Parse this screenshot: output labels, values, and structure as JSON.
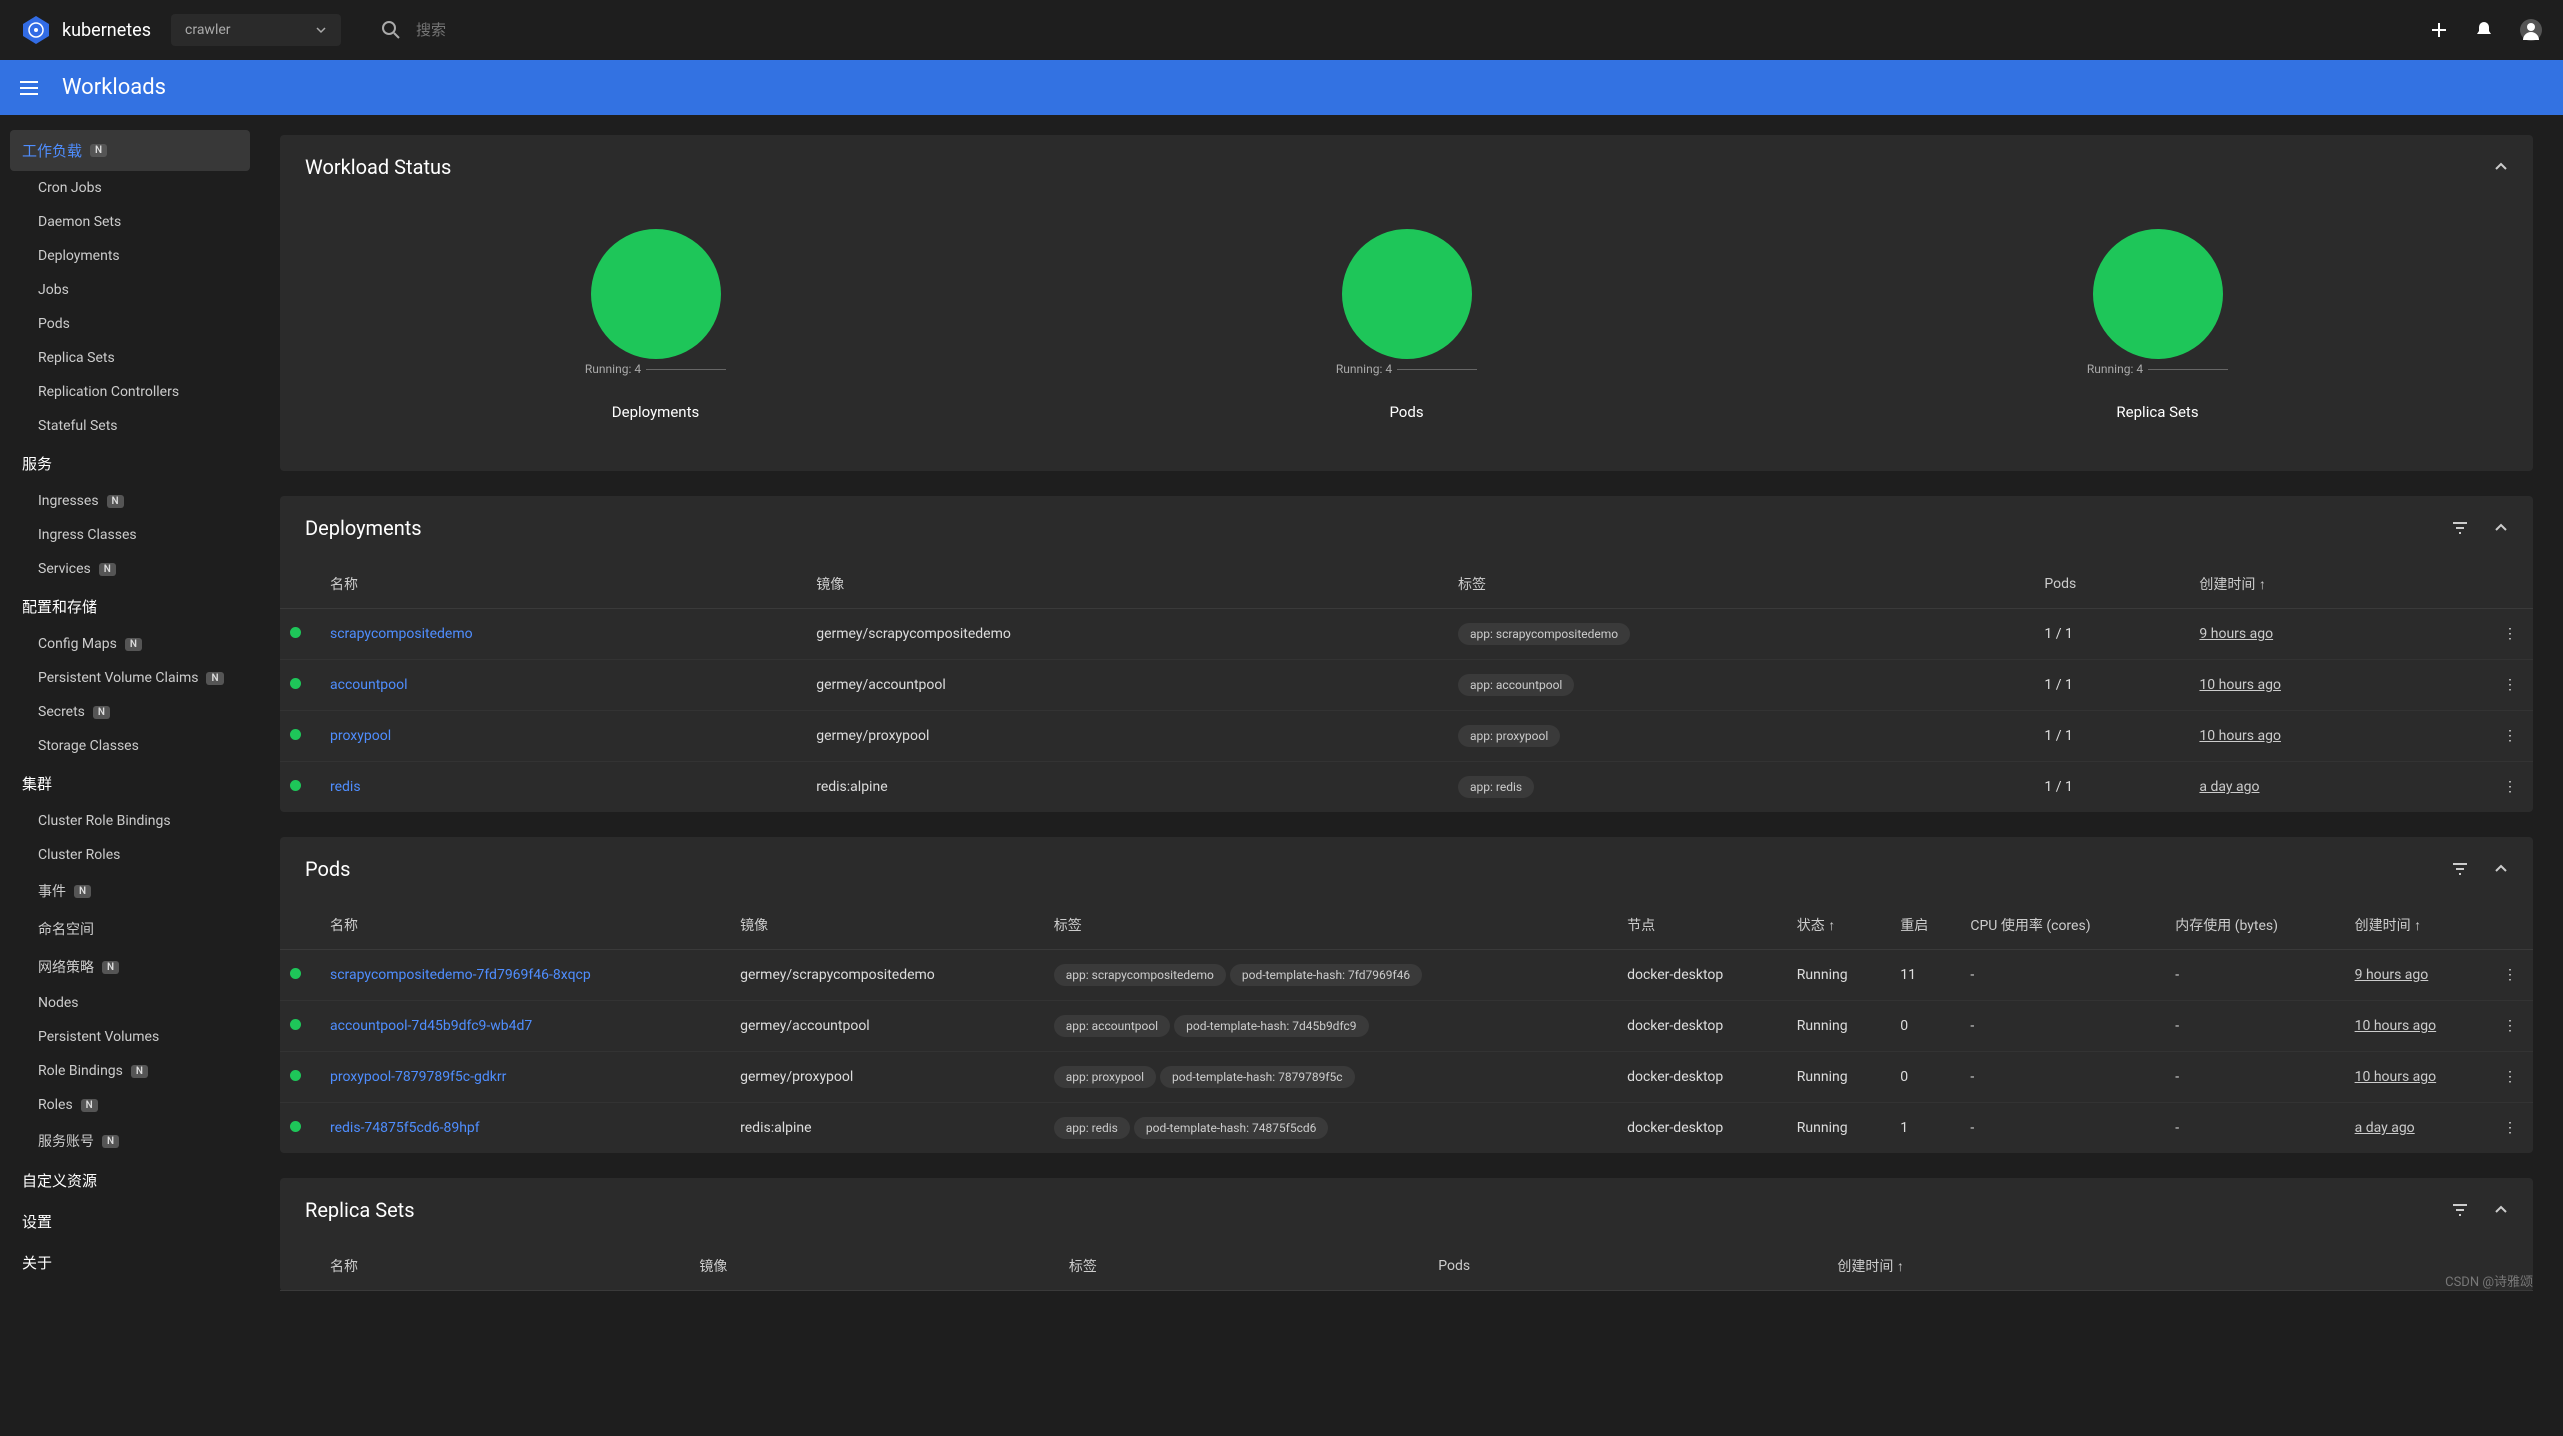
{
  "header": {
    "brand": "kubernetes",
    "namespace": "crawler",
    "search_placeholder": "搜索",
    "title": "Workloads"
  },
  "sidebar": {
    "sections": [
      {
        "label": "工作负载",
        "badge": "N",
        "active": true,
        "items": [
          {
            "label": "Cron Jobs"
          },
          {
            "label": "Daemon Sets"
          },
          {
            "label": "Deployments"
          },
          {
            "label": "Jobs"
          },
          {
            "label": "Pods"
          },
          {
            "label": "Replica Sets"
          },
          {
            "label": "Replication Controllers"
          },
          {
            "label": "Stateful Sets"
          }
        ]
      },
      {
        "label": "服务",
        "items": [
          {
            "label": "Ingresses",
            "badge": "N"
          },
          {
            "label": "Ingress Classes"
          },
          {
            "label": "Services",
            "badge": "N"
          }
        ]
      },
      {
        "label": "配置和存储",
        "items": [
          {
            "label": "Config Maps",
            "badge": "N"
          },
          {
            "label": "Persistent Volume Claims",
            "badge": "N"
          },
          {
            "label": "Secrets",
            "badge": "N"
          },
          {
            "label": "Storage Classes"
          }
        ]
      },
      {
        "label": "集群",
        "items": [
          {
            "label": "Cluster Role Bindings"
          },
          {
            "label": "Cluster Roles"
          },
          {
            "label": "事件",
            "badge": "N"
          },
          {
            "label": "命名空间"
          },
          {
            "label": "网络策略",
            "badge": "N"
          },
          {
            "label": "Nodes"
          },
          {
            "label": "Persistent Volumes"
          },
          {
            "label": "Role Bindings",
            "badge": "N"
          },
          {
            "label": "Roles",
            "badge": "N"
          },
          {
            "label": "服务账号",
            "badge": "N"
          }
        ]
      },
      {
        "label": "自定义资源",
        "items": []
      },
      {
        "label": "设置",
        "items": []
      },
      {
        "label": "关于",
        "items": []
      }
    ]
  },
  "workload_status": {
    "title": "Workload Status",
    "charts": [
      {
        "label": "Deployments",
        "status": "Running: 4"
      },
      {
        "label": "Pods",
        "status": "Running: 4"
      },
      {
        "label": "Replica Sets",
        "status": "Running: 4"
      }
    ]
  },
  "chart_data": [
    {
      "type": "pie",
      "title": "Deployments",
      "categories": [
        "Running"
      ],
      "values": [
        4
      ]
    },
    {
      "type": "pie",
      "title": "Pods",
      "categories": [
        "Running"
      ],
      "values": [
        4
      ]
    },
    {
      "type": "pie",
      "title": "Replica Sets",
      "categories": [
        "Running"
      ],
      "values": [
        4
      ]
    }
  ],
  "deployments": {
    "title": "Deployments",
    "cols": [
      "名称",
      "镜像",
      "标签",
      "Pods",
      "创建时间 ↑"
    ],
    "rows": [
      {
        "name": "scrapycompositedemo",
        "image": "germey/scrapycompositedemo",
        "labels": [
          "app: scrapycompositedemo"
        ],
        "pods": "1 / 1",
        "created": "9 hours ago"
      },
      {
        "name": "accountpool",
        "image": "germey/accountpool",
        "labels": [
          "app: accountpool"
        ],
        "pods": "1 / 1",
        "created": "10 hours ago"
      },
      {
        "name": "proxypool",
        "image": "germey/proxypool",
        "labels": [
          "app: proxypool"
        ],
        "pods": "1 / 1",
        "created": "10 hours ago"
      },
      {
        "name": "redis",
        "image": "redis:alpine",
        "labels": [
          "app: redis"
        ],
        "pods": "1 / 1",
        "created": "a day ago"
      }
    ]
  },
  "pods": {
    "title": "Pods",
    "cols": [
      "名称",
      "镜像",
      "标签",
      "节点",
      "状态 ↑",
      "重启",
      "CPU 使用率 (cores)",
      "内存使用 (bytes)",
      "创建时间 ↑"
    ],
    "rows": [
      {
        "name": "scrapycompositedemo-7fd7969f46-8xqcp",
        "image": "germey/scrapycompositedemo",
        "labels": [
          "app: scrapycompositedemo",
          "pod-template-hash: 7fd7969f46"
        ],
        "node": "docker-desktop",
        "status": "Running",
        "restarts": "11",
        "cpu": "-",
        "mem": "-",
        "created": "9 hours ago"
      },
      {
        "name": "accountpool-7d45b9dfc9-wb4d7",
        "image": "germey/accountpool",
        "labels": [
          "app: accountpool",
          "pod-template-hash: 7d45b9dfc9"
        ],
        "node": "docker-desktop",
        "status": "Running",
        "restarts": "0",
        "cpu": "-",
        "mem": "-",
        "created": "10 hours ago"
      },
      {
        "name": "proxypool-7879789f5c-gdkrr",
        "image": "germey/proxypool",
        "labels": [
          "app: proxypool",
          "pod-template-hash: 7879789f5c"
        ],
        "node": "docker-desktop",
        "status": "Running",
        "restarts": "0",
        "cpu": "-",
        "mem": "-",
        "created": "10 hours ago"
      },
      {
        "name": "redis-74875f5cd6-89hpf",
        "image": "redis:alpine",
        "labels": [
          "app: redis",
          "pod-template-hash: 74875f5cd6"
        ],
        "node": "docker-desktop",
        "status": "Running",
        "restarts": "1",
        "cpu": "-",
        "mem": "-",
        "created": "a day ago"
      }
    ]
  },
  "replica_sets": {
    "title": "Replica Sets",
    "cols": [
      "名称",
      "镜像",
      "标签",
      "Pods",
      "创建时间 ↑"
    ]
  },
  "watermark": "CSDN @诗雅颂"
}
